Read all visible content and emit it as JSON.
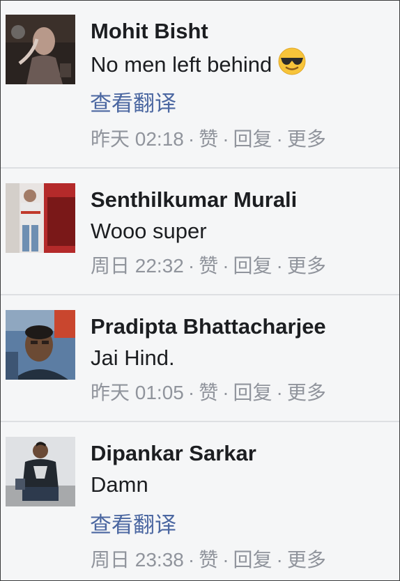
{
  "comments": [
    {
      "author": "Mohit Bisht",
      "text": "No men left behind",
      "emoji": "sunglasses-emoji",
      "translate": "查看翻译",
      "time": "昨天 02:18",
      "sep": "·",
      "like": "赞",
      "reply": "回复",
      "more": "更多"
    },
    {
      "author": "Senthilkumar Murali",
      "text": "Wooo super",
      "time": "周日 22:32",
      "sep": "·",
      "like": "赞",
      "reply": "回复",
      "more": "更多"
    },
    {
      "author": "Pradipta Bhattacharjee",
      "text": "Jai Hind.",
      "time": "昨天 01:05",
      "sep": "·",
      "like": "赞",
      "reply": "回复",
      "more": "更多"
    },
    {
      "author": "Dipankar Sarkar",
      "text": "Damn",
      "translate": "查看翻译",
      "time": "周日 23:38",
      "sep": "·",
      "like": "赞",
      "reply": "回复",
      "more": "更多"
    }
  ],
  "colors": {
    "background": "#f5f6f7",
    "name": "#1c1e21",
    "link": "#4b67a1",
    "meta": "#90949c",
    "divider": "#dddfe2"
  }
}
